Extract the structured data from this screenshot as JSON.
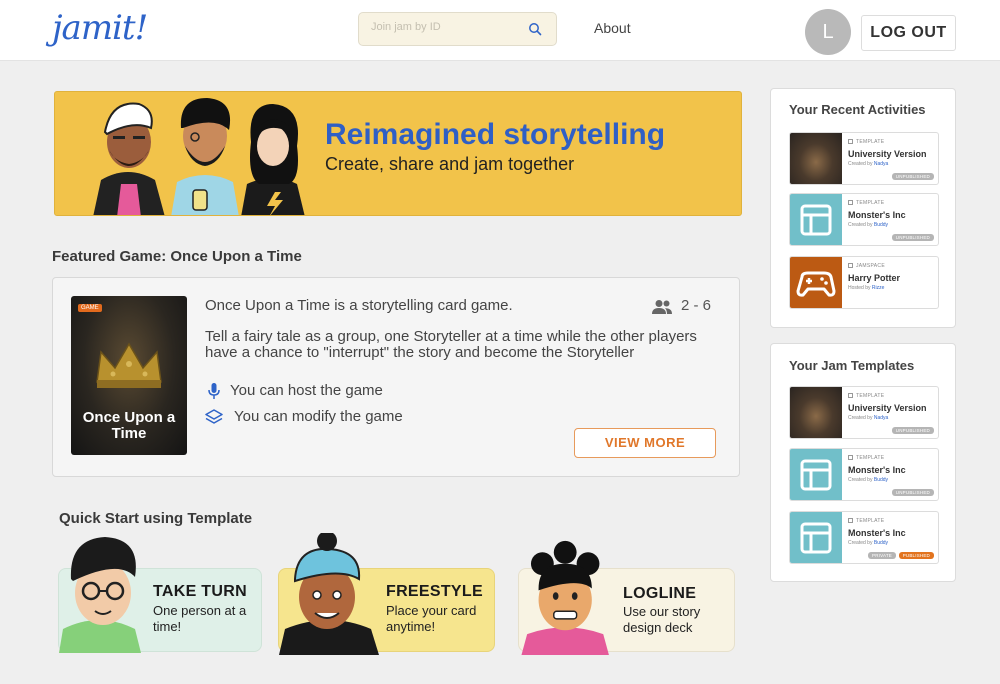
{
  "header": {
    "logo": "jamit!",
    "search_placeholder": "Join jam by ID",
    "about_label": "About",
    "avatar_initial": "L",
    "logout_label": "LOG OUT"
  },
  "banner": {
    "title": "Reimagined storytelling",
    "subtitle": "Create, share and jam together"
  },
  "featured": {
    "section_title": "Featured Game: Once Upon a Time",
    "cover_badge": "GAME",
    "cover_title": "Once Upon a Time",
    "description": "Once Upon a Time is a storytelling card game.",
    "players": "2 - 6",
    "long_description": "Tell a fairy tale as a group, one Storyteller at a time while the other players have a chance to \"interrupt\" the story and become the Storyteller",
    "host_text": "You can host the game",
    "modify_text": "You can modify the game",
    "view_more_label": "VIEW MORE"
  },
  "quick_start": {
    "section_title": "Quick Start using Template",
    "cards": [
      {
        "title": "TAKE TURN",
        "subtitle": "One person at a time!"
      },
      {
        "title": "FREESTYLE",
        "subtitle": "Place your card anytime!"
      },
      {
        "title": "LOGLINE",
        "subtitle": "Use our story design deck"
      }
    ]
  },
  "recent": {
    "title": "Your Recent Activities",
    "items": [
      {
        "type": "TEMPLATE",
        "title": "University Version",
        "by_prefix": "Created by",
        "by": "Nadya",
        "status": "UNPUBLISHED",
        "thumb": "photo-crown"
      },
      {
        "type": "TEMPLATE",
        "title": "Monster's Inc",
        "by_prefix": "Created by",
        "by": "Buddy",
        "status": "UNPUBLISHED",
        "thumb": "layout-icon"
      },
      {
        "type": "JAMSPACE",
        "title": "Harry Potter",
        "by_prefix": "Hosted by",
        "by": "Rizze",
        "status": "",
        "thumb": "gamepad-icon"
      }
    ]
  },
  "templates": {
    "title": "Your Jam Templates",
    "items": [
      {
        "type": "TEMPLATE",
        "title": "University Version",
        "by_prefix": "Created by",
        "by": "Nadya",
        "status": "UNPUBLISHED",
        "thumb": "photo-crown"
      },
      {
        "type": "TEMPLATE",
        "title": "Monster's Inc",
        "by_prefix": "Created by",
        "by": "Buddy",
        "status": "UNPUBLISHED",
        "thumb": "layout-icon"
      },
      {
        "type": "TEMPLATE",
        "title": "Monster's Inc",
        "by_prefix": "Created by",
        "by": "Buddy",
        "private_label": "PRIVATE",
        "status": "PUBLISHED",
        "thumb": "layout-icon"
      }
    ]
  },
  "colors": {
    "brand_blue": "#2e63c8",
    "banner_yellow": "#f2c34a",
    "accent_orange": "#e0772a",
    "teal": "#71bfc9"
  }
}
